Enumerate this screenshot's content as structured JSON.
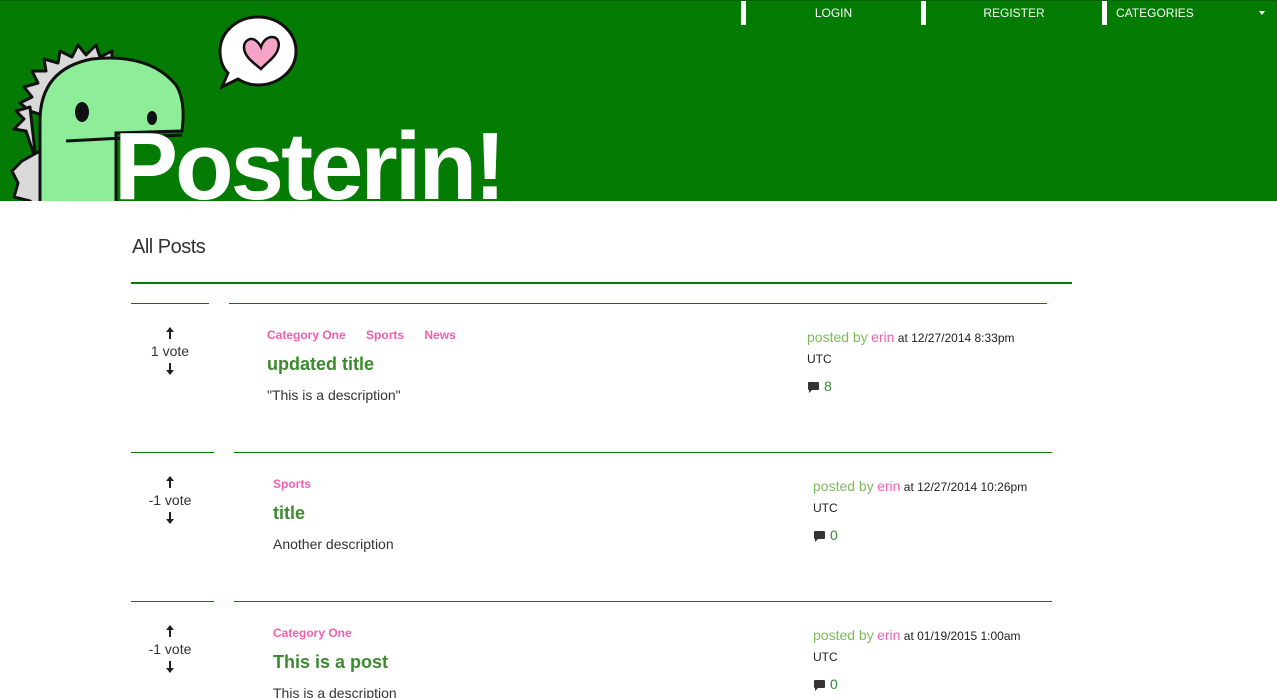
{
  "nav": {
    "login": "LOGIN",
    "register": "REGISTER",
    "categories": "CATEGORIES"
  },
  "brand": "Posterin!",
  "page_title": "All Posts",
  "colors": {
    "header_green": "#047c04",
    "category_pink": "#f25fb0",
    "title_green": "#3b8a2e"
  },
  "posts": [
    {
      "votes": "1 vote",
      "categories": [
        "Category One",
        "Sports",
        "News"
      ],
      "title": "updated title",
      "description": "\"This is a description\"",
      "posted_by": "posted by",
      "user": "erin",
      "date": "at 12/27/2014 8:33pm",
      "tz": "UTC",
      "comments": "8"
    },
    {
      "votes": "-1 vote",
      "categories": [
        "Sports"
      ],
      "title": "title",
      "description": "Another description",
      "posted_by": "posted by",
      "user": "erin",
      "date": "at 12/27/2014 10:26pm",
      "tz": "UTC",
      "comments": "0"
    },
    {
      "votes": "-1 vote",
      "categories": [
        "Category One"
      ],
      "title": "This is a post",
      "description": "This is a description",
      "posted_by": "posted by",
      "user": "erin",
      "date": "at 01/19/2015 1:00am",
      "tz": "UTC",
      "comments": "0"
    }
  ]
}
